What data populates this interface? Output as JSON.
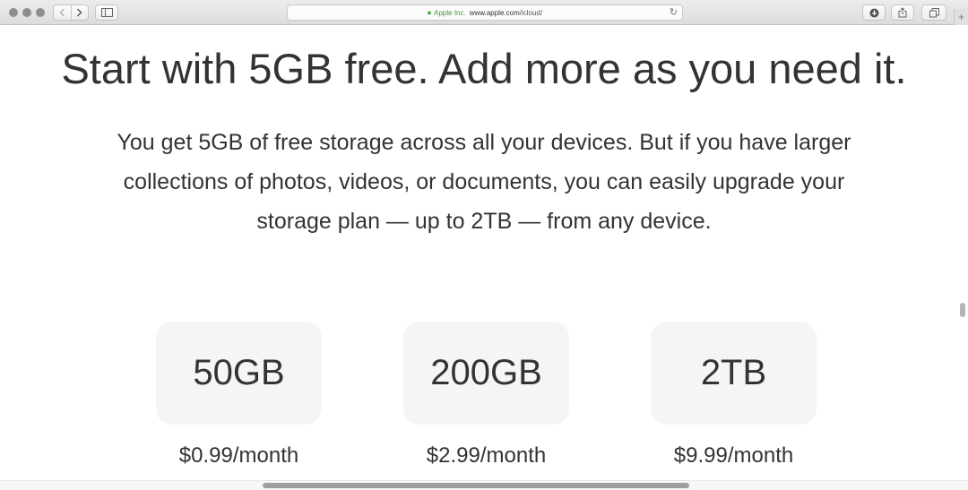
{
  "browser": {
    "address": {
      "company": "Apple Inc.",
      "url_domain": "www.apple.com",
      "url_path": "/icloud/"
    }
  },
  "icons": {
    "window_controls": [
      "close-icon",
      "minimize-icon",
      "maximize-icon"
    ],
    "toolbar": [
      "back-icon",
      "forward-icon",
      "sidebar-icon",
      "lock-icon",
      "reload-icon",
      "download-icon",
      "share-icon",
      "tabs-icon",
      "new-tab-icon"
    ]
  },
  "colors": {
    "secure_green": "#3c9a3c",
    "plan_box_bg": "#f5f5f7",
    "text": "#333333"
  },
  "page": {
    "headline": "Start with 5GB free. Add more as you need it.",
    "subtext_lines": [
      "You get 5GB of free storage across all your devices. But if you have larger",
      "collections of photos, videos, or documents, you can easily upgrade your",
      "storage plan — up to 2TB — from any device."
    ],
    "plans": [
      {
        "size": "50GB",
        "price": "$0.99/month"
      },
      {
        "size": "200GB",
        "price": "$2.99/month"
      },
      {
        "size": "2TB",
        "price": "$9.99/month"
      }
    ]
  }
}
